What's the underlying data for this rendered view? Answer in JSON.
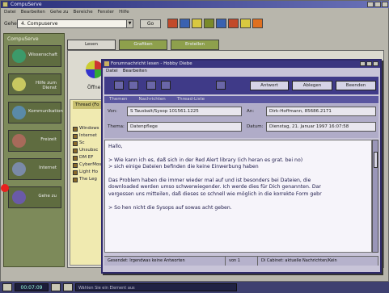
{
  "app": {
    "title": "CompuServe",
    "menu": [
      "Datei",
      "Bearbeiten",
      "Gehe zu",
      "Bereiche",
      "Fenster",
      "Hilfe"
    ]
  },
  "address": {
    "label": "Gehe",
    "value": "4. Compuserve",
    "go_label": "Go"
  },
  "toolbar_icons": [
    {
      "icon": "phone-icon",
      "color": "#c24a2a"
    },
    {
      "icon": "mail-icon",
      "color": "#3a62b0"
    },
    {
      "icon": "forum-icon",
      "color": "#d8c840"
    },
    {
      "icon": "file-icon",
      "color": "#7a8a2a"
    },
    {
      "icon": "print-icon",
      "color": "#3a62b0"
    },
    {
      "icon": "people-icon",
      "color": "#c24a2a"
    },
    {
      "icon": "help-icon",
      "color": "#d8c840"
    },
    {
      "icon": "stop-icon",
      "color": "#e07020"
    }
  ],
  "nav": {
    "title": "CompuServe",
    "items": [
      {
        "label": "Wissenschaft",
        "icon": "globe-icon",
        "color": "#3c9a6a"
      },
      {
        "label": "Hilfe zum Dienst",
        "icon": "help-icon",
        "color": "#c8c860"
      },
      {
        "label": "Kommunikation",
        "icon": "chat-icon",
        "color": "#5a8aa8"
      },
      {
        "label": "Freizeit",
        "icon": "leisure-icon",
        "color": "#a86a5a"
      },
      {
        "label": "Internet",
        "icon": "internet-icon",
        "color": "#7a8aa8"
      },
      {
        "label": "Gehe zu",
        "icon": "goto-icon",
        "color": "#6a5aa8"
      }
    ]
  },
  "tabs": [
    "Lesen",
    "Grafiken",
    "Erstellen"
  ],
  "main": {
    "oeff_label": "Öffne",
    "list_header": "Thread (Fo",
    "list_items": [
      "Windows",
      "Internet",
      "Sc",
      "Unsubsc",
      "DM EF",
      "CyberMos",
      "Light Ho",
      "The Leg"
    ]
  },
  "message_window": {
    "title": "Forumnachricht lesen - Hobby Diebe",
    "menu": [
      "Datei",
      "Bearbeiten"
    ],
    "toolbar_buttons": [
      "Antwort",
      "Ablegen",
      "Beenden"
    ],
    "tabs": [
      "Themen",
      "Nachrichten",
      "Thread-Liste"
    ],
    "from_label": "Von:",
    "from_value": "S Tausbalt/Sysop 101561.1225",
    "to_label": "An:",
    "to_value": "Dirk-Hoffmann, 85686.2171",
    "subject_label": "Thema:",
    "subject_value": "Datenpflege",
    "date_label": "Datum:",
    "date_value": "Dienstag, 21. Januar 1997 16:07:58",
    "body": {
      "greeting": "Hallo,",
      "quote_lines": [
        "> Wie kann ich es, daß sich in der Red Alert library (ich heran es grat. bei no)",
        "> sich einige Dateien befinden die keine Einwerbung haben"
      ],
      "paragraph": [
        "Das Problem haben die immer wieder mal auf und ist besonders bei Dateien, die",
        "downloaded werden umso schwerwiegender. Ich werde dies für Dich genannten. Dar",
        "vergessen uns mitteilen, daß dieses so schnell wie möglich in die korrekte Form gebr"
      ],
      "closing": "> So hen nicht die Sysops auf sowas acht geben."
    },
    "status": [
      "Gesendet: Irgendwas keine Antworten",
      "von 1",
      "Di Cabinet: aktuelle Nachrichten/Kein"
    ]
  },
  "bottom_bar": {
    "time": "00:07:09",
    "status": "Wählen Sie ein Element aus"
  }
}
